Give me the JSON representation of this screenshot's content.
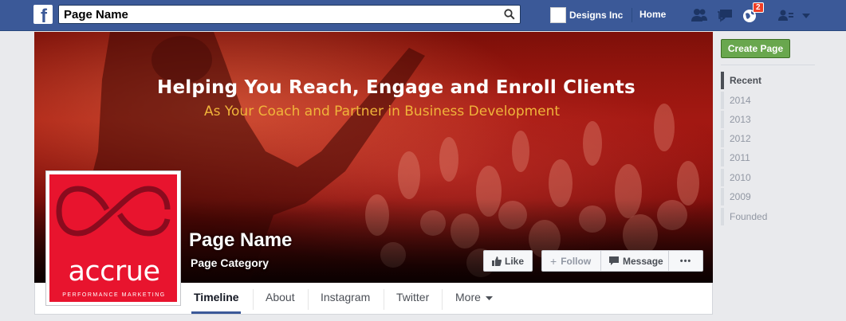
{
  "topbar": {
    "logo_letter": "f",
    "search_value": "Page Name",
    "profile_name": "Designs Inc",
    "home_label": "Home",
    "notification_count": "2",
    "brand_color": "#3b5998"
  },
  "cover": {
    "headline": "Helping You Reach, Engage and Enroll Clients",
    "subheadline": "As Your Coach and Partner in Business Development",
    "subheadline_color": "#f0b43a"
  },
  "page": {
    "name": "Page Name",
    "category": "Page Category"
  },
  "logo": {
    "text": "accrue",
    "tagline": "PERFORMANCE MARKETING",
    "color": "#e8142e"
  },
  "actions": {
    "like": "Like",
    "follow": "Follow",
    "message": "Message",
    "more": "•••"
  },
  "tabs": [
    "Timeline",
    "About",
    "Instagram",
    "Twitter",
    "More"
  ],
  "sidebar": {
    "create_page": "Create Page",
    "years": [
      "Recent",
      "2014",
      "2013",
      "2012",
      "2011",
      "2010",
      "2009",
      "Founded"
    ]
  }
}
